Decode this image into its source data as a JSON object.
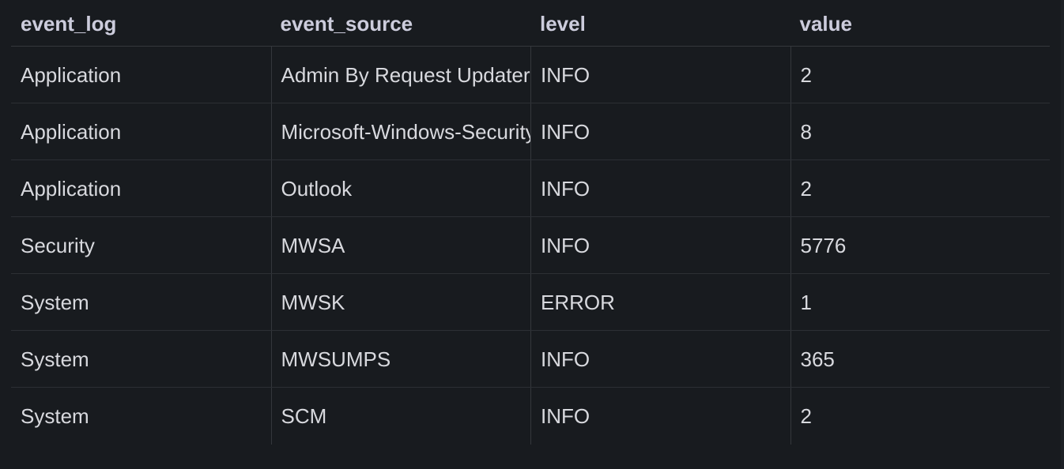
{
  "table": {
    "columns": [
      "event_log",
      "event_source",
      "level",
      "value"
    ],
    "rows": [
      {
        "event_log": "Application",
        "event_source": "Admin By Request Updater",
        "level": "INFO",
        "value": "2"
      },
      {
        "event_log": "Application",
        "event_source": "Microsoft-Windows-Security-SPP",
        "level": "INFO",
        "value": "8"
      },
      {
        "event_log": "Application",
        "event_source": "Outlook",
        "level": "INFO",
        "value": "2"
      },
      {
        "event_log": "Security",
        "event_source": "MWSA",
        "level": "INFO",
        "value": "5776"
      },
      {
        "event_log": "System",
        "event_source": "MWSK",
        "level": "ERROR",
        "value": "1"
      },
      {
        "event_log": "System",
        "event_source": "MWSUMPS",
        "level": "INFO",
        "value": "365"
      },
      {
        "event_log": "System",
        "event_source": "SCM",
        "level": "INFO",
        "value": "2"
      }
    ]
  }
}
